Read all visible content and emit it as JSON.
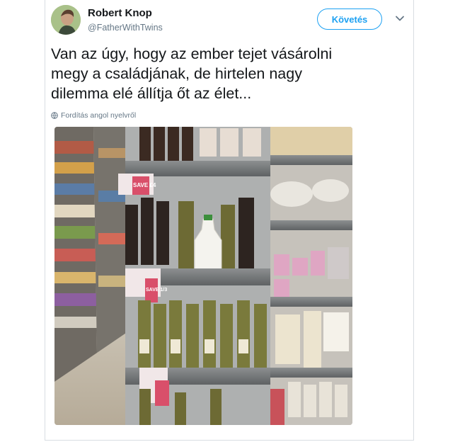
{
  "tweet": {
    "author_name": "Robert Knop",
    "author_handle": "@FatherWithTwins",
    "follow_label": "Követés",
    "text": "Van az úgy, hogy az ember tejet vásárolni\nmegy a családjának, de hirtelen nagy\ndilemma elé állítja őt az élet...",
    "translate_label": "Fordítás angol nyelvről"
  },
  "photo": {
    "price_tags": [
      "SAVE £4",
      "SAVE 1/3"
    ]
  },
  "colors": {
    "accent": "#1da1f2",
    "text_primary": "#14171a",
    "text_secondary": "#657786"
  }
}
